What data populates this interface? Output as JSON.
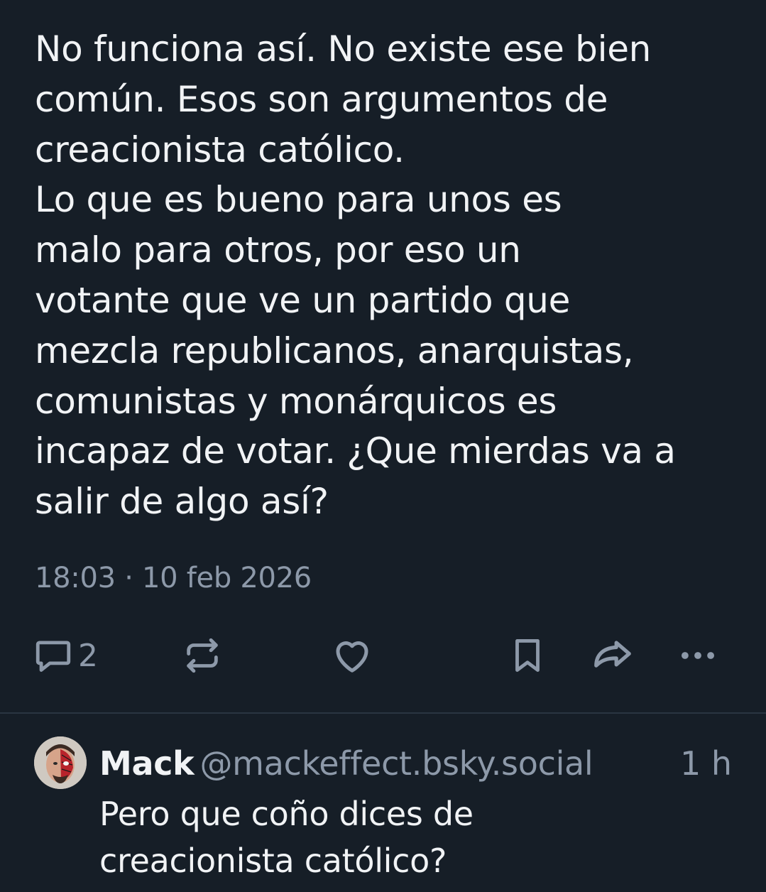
{
  "post": {
    "text_lines": [
      "No funciona así. No existe ese bien",
      "común. Esos son argumentos de",
      "creacionista católico.",
      "Lo que es bueno para unos es",
      "malo para otros, por eso un",
      "votante que ve un partido que",
      "mezcla republicanos, anarquistas,",
      "comunistas y monárquicos es",
      "incapaz de votar. ¿Que mierdas va a",
      "salir de algo así?"
    ],
    "timestamp": "18:03 · 10 feb 2026",
    "actions": {
      "reply_count": "2",
      "reply_icon": "comment-icon",
      "repost_icon": "repost-icon",
      "like_icon": "heart-icon",
      "bookmark_icon": "bookmark-icon",
      "share_icon": "share-icon",
      "more_icon": "more-icon"
    }
  },
  "reply": {
    "author_name": "Mack",
    "author_handle": "@mackeffect.bsky.social",
    "time": "1 h",
    "text_lines": [
      "Pero que coño dices de",
      "creacionista católico?"
    ]
  },
  "colors": {
    "background": "#161e27",
    "text": "#f1f3f5",
    "muted": "#8d99a9",
    "divider": "#2a3542"
  }
}
